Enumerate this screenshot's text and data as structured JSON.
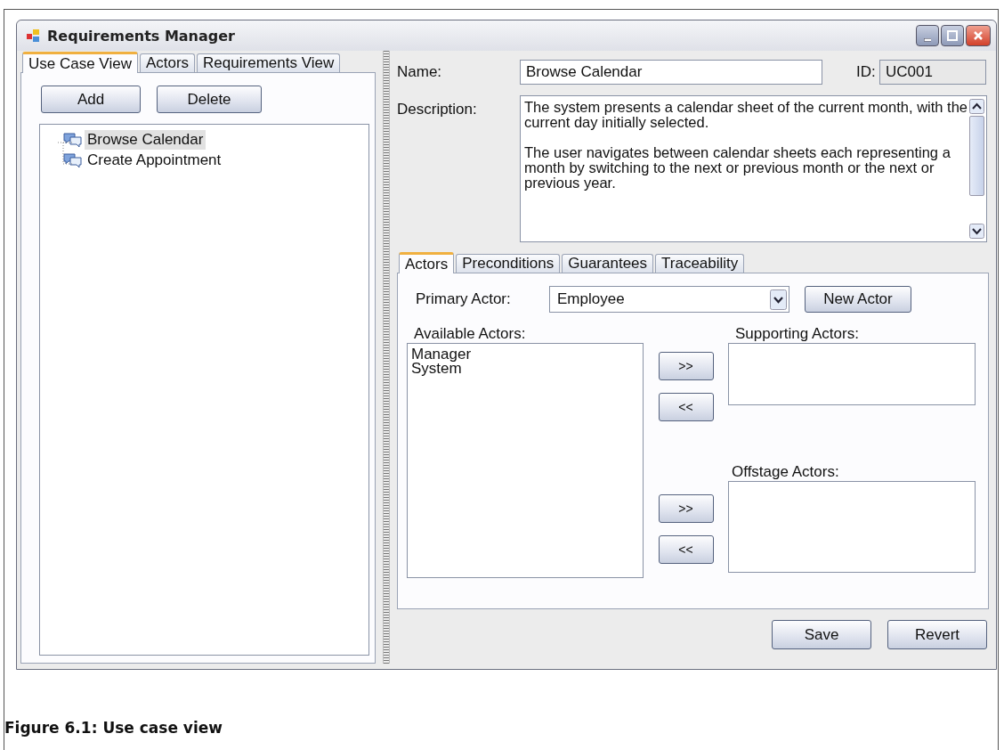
{
  "window": {
    "title": "Requirements Manager"
  },
  "left_tabs": [
    {
      "label": "Use Case View",
      "selected": true
    },
    {
      "label": "Actors",
      "selected": false
    },
    {
      "label": "Requirements View",
      "selected": false
    }
  ],
  "left_buttons": [
    "Add",
    "Delete"
  ],
  "tree": [
    {
      "label": "Browse Calendar",
      "selected": true
    },
    {
      "label": "Create Appointment",
      "selected": false
    }
  ],
  "form": {
    "name_label": "Name:",
    "name_value": "Browse Calendar",
    "id_label": "ID:",
    "id_value": "UC001",
    "description_label": "Description:",
    "description": "The system presents a calendar sheet of the current month, with the current day initially selected.\n\nThe user navigates between calendar sheets each representing a month by switching to the next or previous month or the next or previous year."
  },
  "detail_tabs": [
    {
      "label": "Actors",
      "selected": true
    },
    {
      "label": "Preconditions",
      "selected": false
    },
    {
      "label": "Guarantees",
      "selected": false
    },
    {
      "label": "Traceability",
      "selected": false
    }
  ],
  "actors": {
    "primary_label": "Primary Actor:",
    "primary_value": "Employee",
    "new_actor_button": "New Actor",
    "available_label": "Available Actors:",
    "available": [
      "Manager",
      "System"
    ],
    "supporting_label": "Supporting Actors:",
    "supporting_buttons": [
      ">>",
      "<<"
    ],
    "offstage_label": "Offstage Actors:",
    "offstage_buttons": [
      ">>",
      "<<"
    ]
  },
  "footer_buttons": [
    "Save",
    "Revert"
  ],
  "caption": "Figure 6.1: Use case view"
}
